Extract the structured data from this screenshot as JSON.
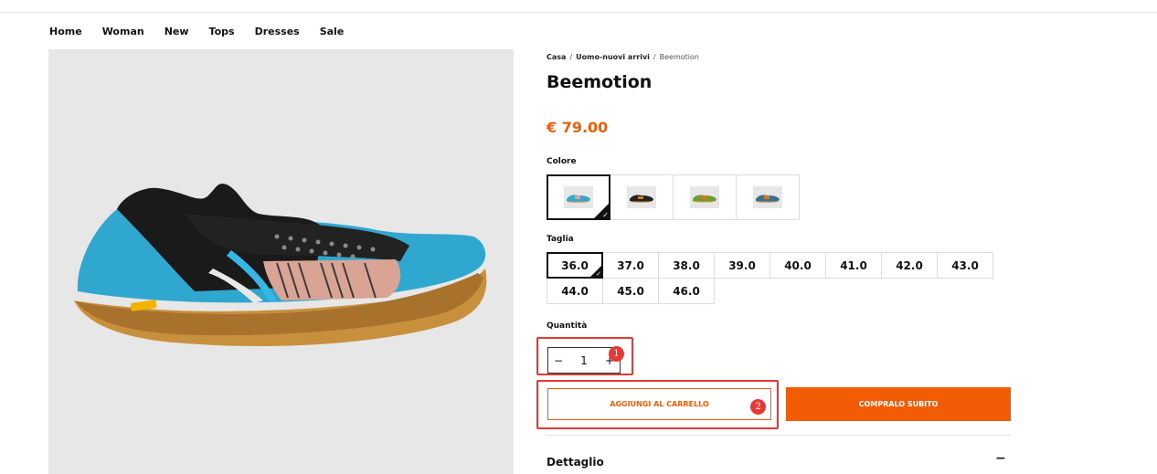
{
  "nav": {
    "items": [
      "Home",
      "Woman",
      "New",
      "Tops",
      "Dresses",
      "Sale"
    ]
  },
  "breadcrumb": {
    "items": [
      "Casa",
      "Uomo-nuovi arrivi",
      "Beemotion"
    ],
    "separator": "/"
  },
  "product": {
    "title": "Beemotion",
    "price": "€ 79.00",
    "image_icon": "shoe-image"
  },
  "color": {
    "label": "Colore",
    "swatches": [
      "blue-pink",
      "black-orange",
      "green-orange",
      "blue-orange"
    ],
    "selected_index": 0
  },
  "size": {
    "label": "Taglia",
    "options": [
      "36.0",
      "37.0",
      "38.0",
      "39.0",
      "40.0",
      "41.0",
      "42.0",
      "43.0",
      "44.0",
      "45.0",
      "46.0"
    ],
    "selected": "36.0"
  },
  "quantity": {
    "label": "Quantità",
    "minus": "−",
    "value": "1",
    "plus": "+"
  },
  "annotations": {
    "badge_1": "1",
    "badge_2": "2"
  },
  "actions": {
    "add_to_cart": "AGGIUNGI AL CARRELLO",
    "buy_now": "COMPRALO SUBITO"
  },
  "details": {
    "title": "Dettaglio",
    "toggle": "−"
  },
  "colors": {
    "accent": "#f25c05",
    "annotation": "#e53935"
  }
}
